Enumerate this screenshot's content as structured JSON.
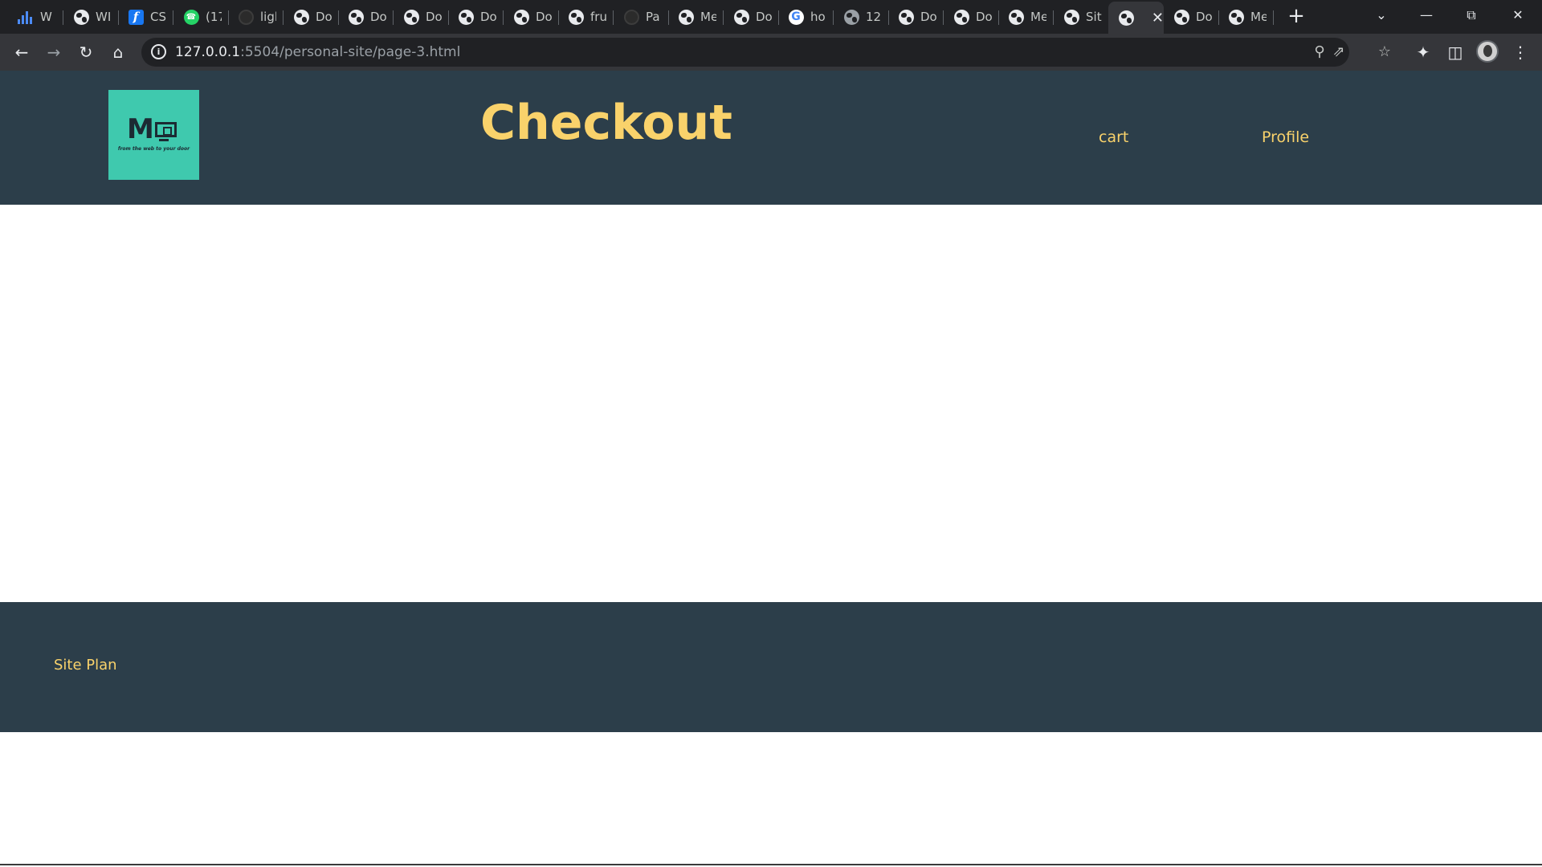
{
  "browser": {
    "tabs": [
      {
        "title": "W",
        "icon": "bar-chart-icon"
      },
      {
        "title": "WI",
        "icon": "globe-icon"
      },
      {
        "title": "CS",
        "icon": "f-logo-icon"
      },
      {
        "title": "(17",
        "icon": "whatsapp-icon"
      },
      {
        "title": "ligl",
        "icon": "github-icon"
      },
      {
        "title": "Do",
        "icon": "globe-icon"
      },
      {
        "title": "Do",
        "icon": "globe-icon"
      },
      {
        "title": "Do",
        "icon": "globe-icon"
      },
      {
        "title": "Do",
        "icon": "globe-icon"
      },
      {
        "title": "Do",
        "icon": "globe-icon"
      },
      {
        "title": "fru",
        "icon": "globe-icon"
      },
      {
        "title": "Pa",
        "icon": "github-icon"
      },
      {
        "title": "Me",
        "icon": "globe-icon"
      },
      {
        "title": "Do",
        "icon": "globe-icon"
      },
      {
        "title": "ho",
        "icon": "google-icon"
      },
      {
        "title": "12",
        "icon": "globe-gray-icon"
      },
      {
        "title": "Do",
        "icon": "globe-icon"
      },
      {
        "title": "Do",
        "icon": "globe-icon"
      },
      {
        "title": "Me",
        "icon": "globe-icon"
      },
      {
        "title": "Sit",
        "icon": "globe-icon"
      },
      {
        "title": "",
        "icon": "globe-icon",
        "active": true
      },
      {
        "title": "Do",
        "icon": "globe-icon"
      },
      {
        "title": "Me",
        "icon": "globe-icon"
      }
    ],
    "address": {
      "host": "127.0.0.1",
      "path": ":5504/personal-site/page-3.html"
    }
  },
  "site": {
    "logo": {
      "letter": "M",
      "tagline": "from the web to your door"
    },
    "title": "Checkout",
    "nav": {
      "cart": "cart",
      "profile": "Profile"
    },
    "footer": {
      "site_plan": "Site Plan"
    },
    "colors": {
      "header_bg": "#2c3e4a",
      "accent_text": "#f9d26b",
      "logo_bg": "#3fc9ae"
    }
  }
}
